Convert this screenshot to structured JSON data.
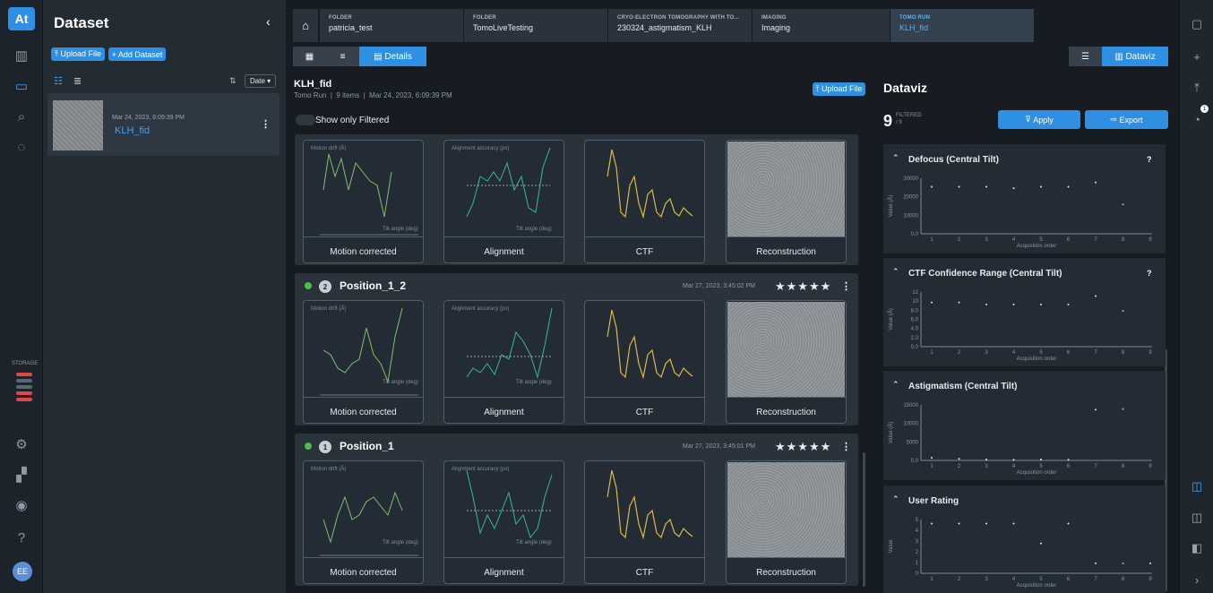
{
  "nav": {
    "logo": "At",
    "storage": "STORAGE",
    "avatar": "EE"
  },
  "dataset": {
    "title": "Dataset",
    "upload_label": "⤒ Upload File",
    "add_label": "+ Add Dataset",
    "sort_label": "Date ▾",
    "item": {
      "date": "Mar 24, 2023, 6:09:39 PM",
      "name": "KLH_fid"
    }
  },
  "breadcrumb": [
    {
      "type": "FOLDER",
      "value": "patricia_test"
    },
    {
      "type": "FOLDER",
      "value": "TomoLiveTesting"
    },
    {
      "type": "CRYO-ELECTRON TOMOGRAPHY WITH TO...",
      "value": "230324_astigmatism_KLH"
    },
    {
      "type": "IMAGING",
      "value": "Imaging"
    },
    {
      "type": "TOMO RUN",
      "value": "KLH_fid"
    }
  ],
  "toolbar": {
    "details_label": "Details",
    "dataviz_label": "Dataviz"
  },
  "run": {
    "title": "KLH_fid",
    "meta": "Tomo Run  |  9 items  |  Mar 24, 2023, 6:09:39 PM",
    "upload_label": "⤒ Upload File",
    "filter_label": "Show only Filtered"
  },
  "plots": {
    "motion_label": "Motion corrected",
    "alignment_label": "Alignment",
    "ctf_label": "CTF",
    "recon_label": "Reconstruction",
    "motion_axis": "Motion drift (Å)",
    "align_axis": "Alignment accuracy (px)",
    "tilt_axis": "Tilt angle (deg)"
  },
  "positions": [
    {
      "index": "2",
      "name": "Position_1_2",
      "date": "Mar 27, 2023, 3:45:02 PM",
      "rating": "★★★★★"
    },
    {
      "index": "1",
      "name": "Position_1",
      "date": "Mar 27, 2023, 3:45:01 PM",
      "rating": "★★★★★"
    }
  ],
  "dataviz": {
    "title": "Dataviz",
    "count": "9",
    "filtered_label": "FILTERED",
    "total": "/ 9",
    "apply_label": "Apply",
    "export_label": "Export",
    "charts": [
      {
        "title": "Defocus (Central Tilt)",
        "help": "?",
        "ylabel": "Value (Å)",
        "xlabel": "Acquisition order",
        "yticks": [
          "30000",
          "20000",
          "10000",
          "0.0"
        ],
        "values": [
          32000,
          32000,
          32000,
          31000,
          32000,
          32000,
          35000,
          20000,
          null
        ]
      },
      {
        "title": "CTF Confidence Range (Central Tilt)",
        "help": "?",
        "ylabel": "Value (Å)",
        "xlabel": "Acquisition order",
        "yticks": [
          "12",
          "10",
          "8.0",
          "6.0",
          "4.0",
          "2.0",
          "0.0"
        ],
        "values": [
          10.5,
          10.5,
          10,
          10,
          10,
          10,
          12,
          8.5,
          null
        ]
      },
      {
        "title": "Astigmatism (Central Tilt)",
        "help": "",
        "ylabel": "Value (Å)",
        "xlabel": "Acquisition order",
        "yticks": [
          "15000",
          "10000",
          "5000",
          "0.0"
        ],
        "values": [
          800,
          500,
          300,
          200,
          300,
          200,
          15000,
          15200,
          null
        ]
      },
      {
        "title": "User Rating",
        "help": "",
        "ylabel": "Value",
        "xlabel": "Acquisition order",
        "yticks": [
          "5",
          "4",
          "3",
          "2",
          "1",
          "0"
        ],
        "values": [
          5,
          5,
          5,
          5,
          3,
          5,
          1,
          1,
          1
        ]
      }
    ],
    "xticks": [
      "1",
      "2",
      "3",
      "4",
      "5",
      "6",
      "7",
      "8",
      "9"
    ]
  },
  "colors": {
    "accent": "#2f8fe3",
    "motion": "#7fbf6a",
    "align": "#3bb3a8",
    "ctf": "#d8b84a"
  }
}
